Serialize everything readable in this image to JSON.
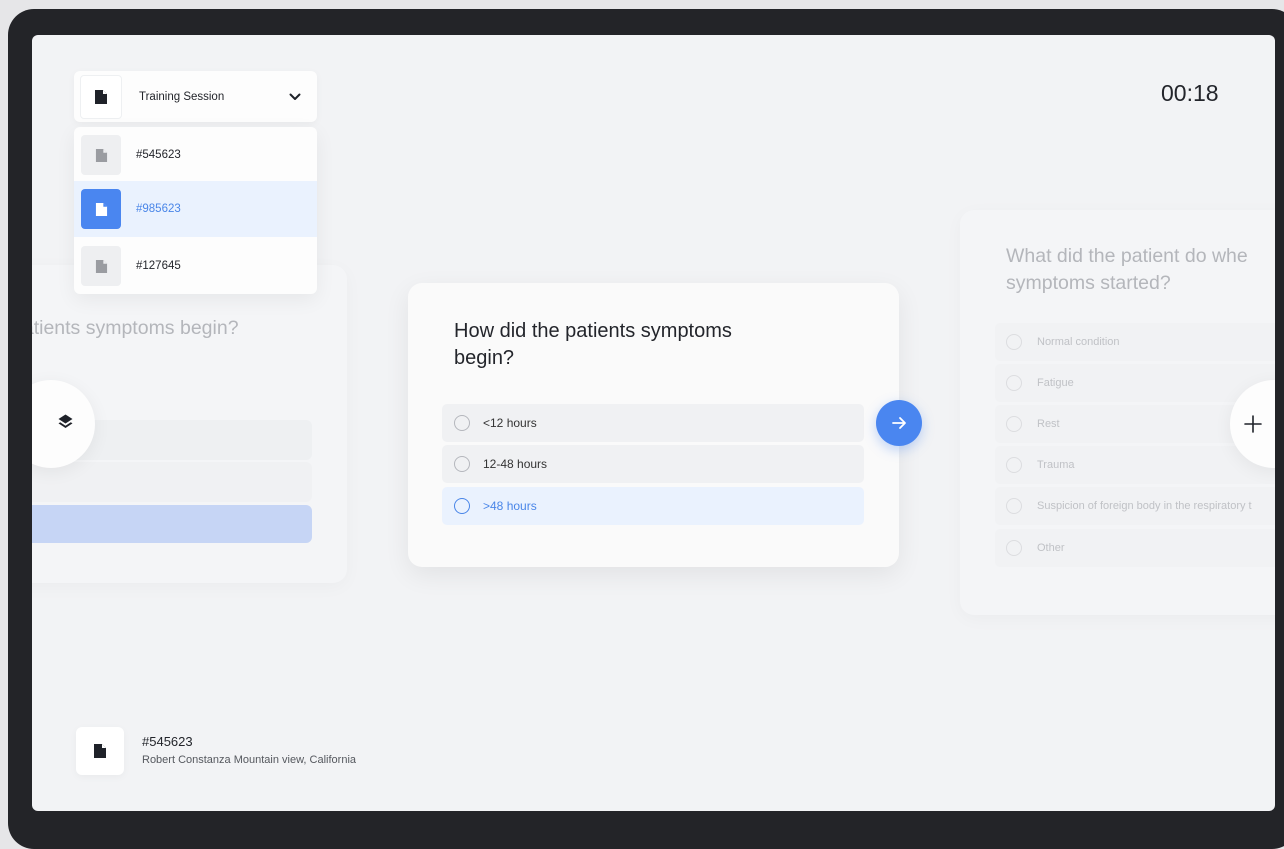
{
  "timer": "00:18",
  "session_dropdown": {
    "selected": "Training Session",
    "items": [
      {
        "label": "#545623",
        "active": false
      },
      {
        "label": "#985623",
        "active": true
      },
      {
        "label": "#127645",
        "active": false
      }
    ]
  },
  "left_card": {
    "question": "patients symptoms begin?"
  },
  "main_card": {
    "question": "How did the patients symptoms begin?",
    "options": [
      {
        "label": "<12 hours",
        "selected": false
      },
      {
        "label": "12-48 hours",
        "selected": false
      },
      {
        "label": ">48 hours",
        "selected": true
      }
    ]
  },
  "right_card": {
    "question_line1": "What did the patient do whe",
    "question_line2": "symptoms started?",
    "options": [
      "Normal condition",
      "Fatigue",
      "Rest",
      "Trauma",
      "Suspicion of foreign body in the respiratory t",
      "Other"
    ]
  },
  "patient": {
    "id": "#545623",
    "subtitle": "Robert Constanza Mountain view, California"
  },
  "colors": {
    "accent": "#4a86f0",
    "selected_bg": "#eaf2fe",
    "frame": "#232428"
  },
  "icons": {
    "document": "document-icon",
    "layers": "layers-icon",
    "plus": "plus-icon",
    "arrow": "arrow-right-icon",
    "chevron": "chevron-down-icon"
  }
}
